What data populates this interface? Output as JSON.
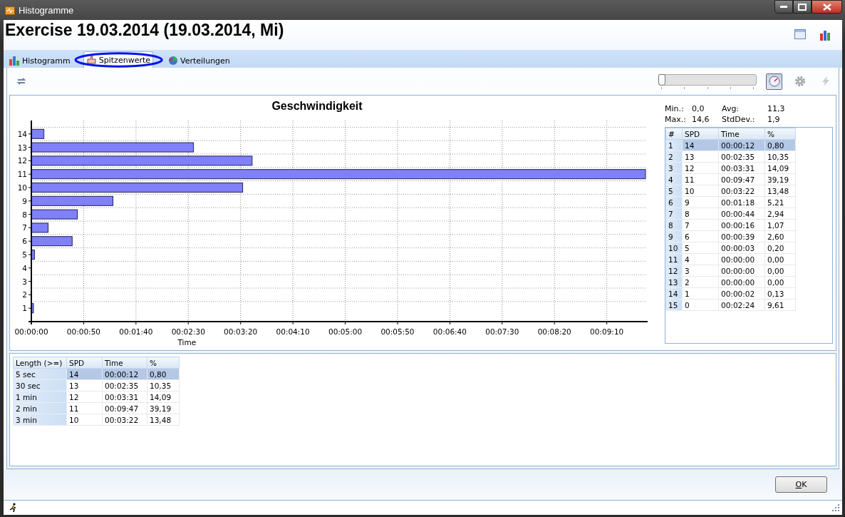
{
  "window": {
    "title": "Histogramme"
  },
  "header": {
    "title": "Exercise 19.03.2014 (19.03.2014, Mi)"
  },
  "tabs": [
    {
      "label": "Histogramm",
      "selected": false
    },
    {
      "label": "Spitzenwerte",
      "selected": true
    },
    {
      "label": "Verteilungen",
      "selected": false
    }
  ],
  "toolbar": {
    "slider": {
      "level": 0
    },
    "tool_buttons": [
      {
        "kind": "gauge",
        "pressed": true,
        "disabled": false
      },
      {
        "kind": "gear",
        "pressed": false,
        "disabled": false
      },
      {
        "kind": "lightning",
        "pressed": false,
        "disabled": true
      }
    ]
  },
  "chart": {
    "chart_data": {
      "type": "bar",
      "orientation": "horizontal",
      "title": "Geschwindigkeit",
      "xlabel": "Time",
      "categories": [
        "14",
        "13",
        "12",
        "11",
        "10",
        "9",
        "8",
        "7",
        "6",
        "5",
        "4",
        "3",
        "2",
        "1"
      ],
      "values": [
        12,
        155,
        211,
        587,
        202,
        78,
        44,
        16,
        39,
        3,
        0,
        0,
        0,
        2
      ],
      "xlim": [
        0,
        587
      ],
      "grid": true,
      "xticks": [
        {
          "value": 0,
          "label": "00:00:00"
        },
        {
          "value": 50,
          "label": "00:00:50"
        },
        {
          "value": 100,
          "label": "00:01:40"
        },
        {
          "value": 150,
          "label": "00:02:30"
        },
        {
          "value": 200,
          "label": "00:03:20"
        },
        {
          "value": 250,
          "label": "00:04:10"
        },
        {
          "value": 300,
          "label": "00:05:00"
        },
        {
          "value": 350,
          "label": "00:05:50"
        },
        {
          "value": 400,
          "label": "00:06:40"
        },
        {
          "value": 450,
          "label": "00:07:30"
        },
        {
          "value": 500,
          "label": "00:08:20"
        },
        {
          "value": 550,
          "label": "00:09:10"
        }
      ]
    }
  },
  "stats": [
    {
      "label": "Min.:",
      "value": "0,0"
    },
    {
      "label": "Avg:",
      "value": "11,3"
    },
    {
      "label": "Max.:",
      "value": "14,6"
    },
    {
      "label": "StdDev.:",
      "value": "1,9"
    }
  ],
  "speed_table": {
    "columns": [
      "#",
      "SPD",
      "Time",
      "%"
    ],
    "rows": [
      {
        "cells": [
          "1",
          "14",
          "00:00:12",
          "0,80"
        ],
        "selected": true
      },
      {
        "cells": [
          "2",
          "13",
          "00:02:35",
          "10,35"
        ],
        "selected": false
      },
      {
        "cells": [
          "3",
          "12",
          "00:03:31",
          "14,09"
        ],
        "selected": false
      },
      {
        "cells": [
          "4",
          "11",
          "00:09:47",
          "39,19"
        ],
        "selected": false
      },
      {
        "cells": [
          "5",
          "10",
          "00:03:22",
          "13,48"
        ],
        "selected": false
      },
      {
        "cells": [
          "6",
          "9",
          "00:01:18",
          "5,21"
        ],
        "selected": false
      },
      {
        "cells": [
          "7",
          "8",
          "00:00:44",
          "2,94"
        ],
        "selected": false
      },
      {
        "cells": [
          "8",
          "7",
          "00:00:16",
          "1,07"
        ],
        "selected": false
      },
      {
        "cells": [
          "9",
          "6",
          "00:00:39",
          "2,60"
        ],
        "selected": false
      },
      {
        "cells": [
          "10",
          "5",
          "00:00:03",
          "0,20"
        ],
        "selected": false
      },
      {
        "cells": [
          "11",
          "4",
          "00:00:00",
          "0,00"
        ],
        "selected": false
      },
      {
        "cells": [
          "12",
          "3",
          "00:00:00",
          "0,00"
        ],
        "selected": false
      },
      {
        "cells": [
          "13",
          "2",
          "00:00:00",
          "0,00"
        ],
        "selected": false
      },
      {
        "cells": [
          "14",
          "1",
          "00:00:02",
          "0,13"
        ],
        "selected": false
      },
      {
        "cells": [
          "15",
          "0",
          "00:02:24",
          "9,61"
        ],
        "selected": false
      }
    ]
  },
  "peak_table": {
    "columns": [
      "Length (>=)",
      "SPD",
      "Time",
      "%"
    ],
    "rows": [
      {
        "cells": [
          "5 sec",
          "14",
          "00:00:12",
          "0,80"
        ],
        "selected": true
      },
      {
        "cells": [
          "30 sec",
          "13",
          "00:02:35",
          "10,35"
        ],
        "selected": false
      },
      {
        "cells": [
          "1 min",
          "12",
          "00:03:31",
          "14,09"
        ],
        "selected": false
      },
      {
        "cells": [
          "2 min",
          "11",
          "00:09:47",
          "39,19"
        ],
        "selected": false
      },
      {
        "cells": [
          "3 min",
          "10",
          "00:03:22",
          "13,48"
        ],
        "selected": false
      }
    ]
  },
  "ok_button": {
    "label": "OK"
  }
}
